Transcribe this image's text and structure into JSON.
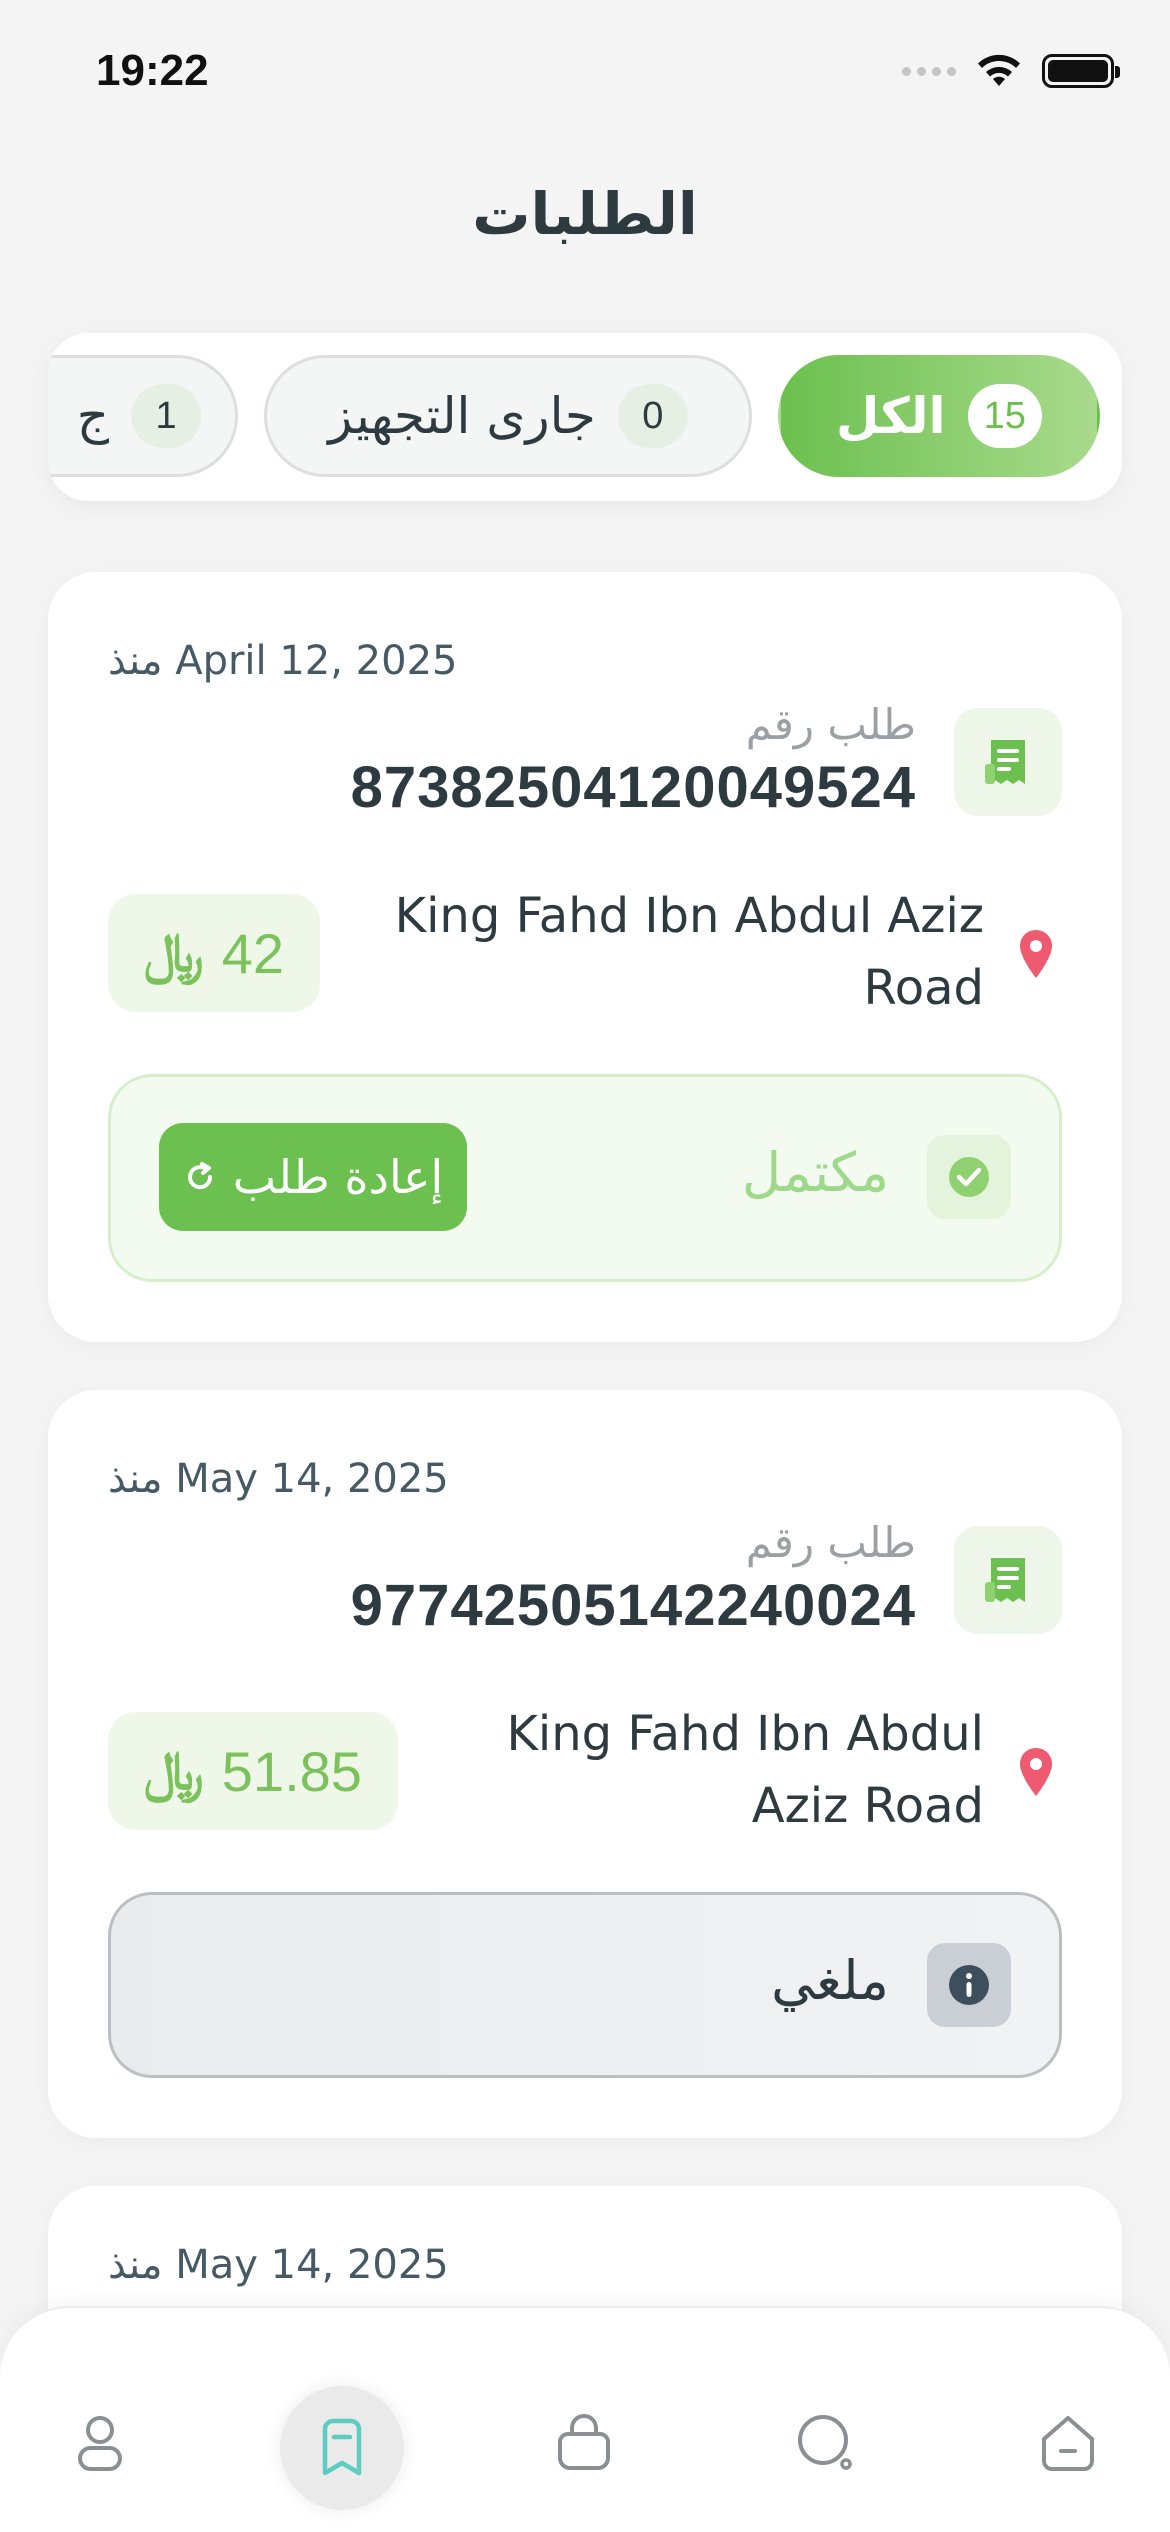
{
  "status_bar": {
    "time": "19:22"
  },
  "header": {
    "title": "الطلبات"
  },
  "tabs": [
    {
      "label": "الكل",
      "count": "15",
      "active": true
    },
    {
      "label": "جارى التجهيز",
      "count": "0",
      "active": false
    },
    {
      "label": "ج",
      "count": "1",
      "active": false
    }
  ],
  "orders": [
    {
      "date": "منذ April 12, 2025",
      "label": "طلب رقم",
      "number": "87382504120049524",
      "address": "King Fahd Ibn Abdul Aziz Road",
      "price": "42",
      "status": "مكتمل",
      "status_type": "completed",
      "reorder_label": "إعادة طلب"
    },
    {
      "date": "منذ May 14, 2025",
      "label": "طلب رقم",
      "number": "97742505142240024",
      "address": "King Fahd Ibn Abdul Aziz Road",
      "price": "51.85",
      "status": "ملغي",
      "status_type": "cancelled"
    },
    {
      "date": "منذ May 14, 2025"
    }
  ],
  "currency_symbol": "﷼",
  "bottom_nav": [
    {
      "icon": "profile-icon"
    },
    {
      "icon": "orders-icon",
      "active": true
    },
    {
      "icon": "bag-icon"
    },
    {
      "icon": "search-icon"
    },
    {
      "icon": "home-icon"
    }
  ],
  "colors": {
    "brand_green": "#6cc04f",
    "brand_green_light": "#a8da8c",
    "text_dark": "#2d3a40",
    "pin_red": "#ee5a6f",
    "nav_active_teal": "#5ccdc2"
  }
}
